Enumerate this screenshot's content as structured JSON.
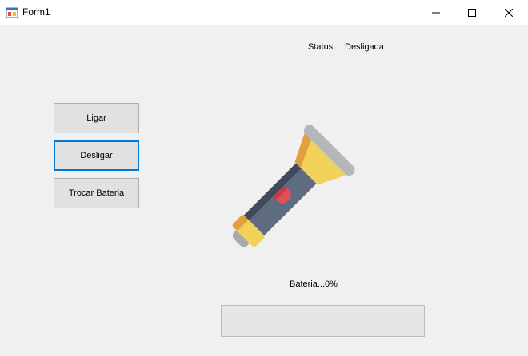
{
  "window": {
    "title": "Form1"
  },
  "status": {
    "label": "Status:",
    "value": "Desligada"
  },
  "buttons": {
    "ligar": "Ligar",
    "desligar": "Desligar",
    "trocar_bateria": "Trocar Bateria"
  },
  "battery": {
    "label": "Bateria...0%",
    "progress": 0
  },
  "icons": {
    "app": "form-app-icon",
    "minimize": "minimize-icon",
    "maximize": "maximize-icon",
    "close": "close-icon",
    "flashlight": "flashlight-icon"
  }
}
